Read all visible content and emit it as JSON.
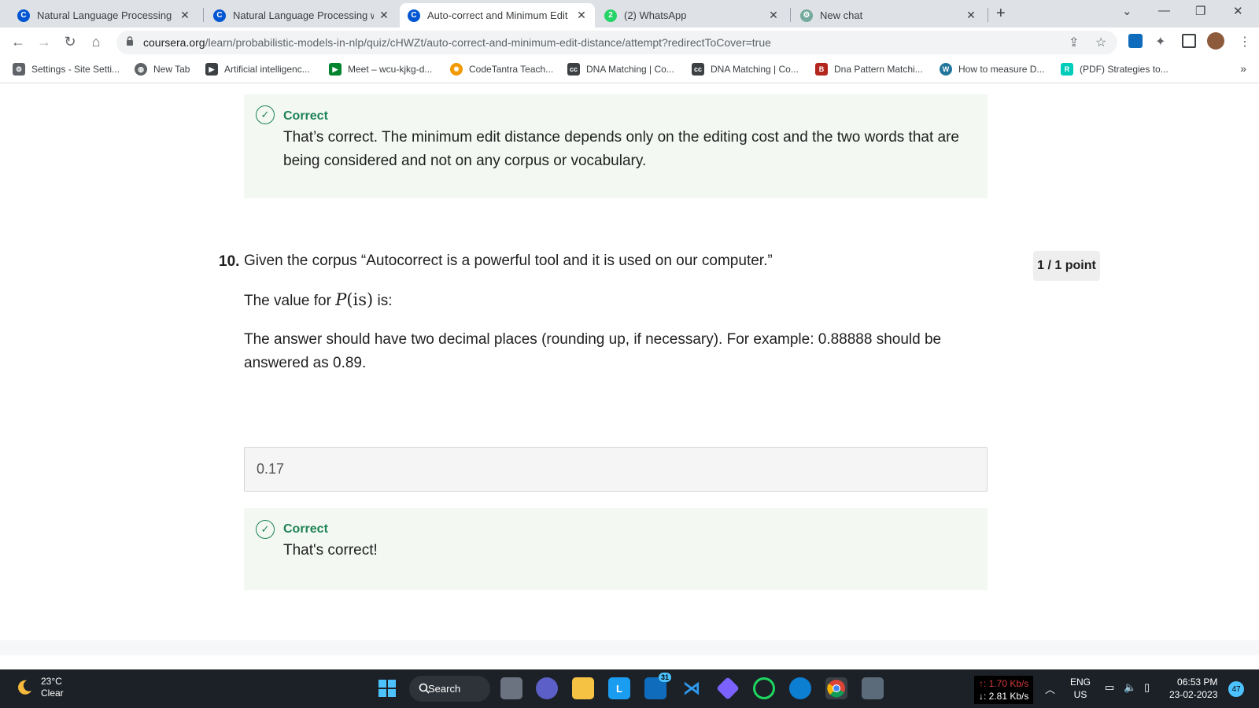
{
  "browser": {
    "tabs": [
      {
        "title": "Natural Language Processing - G",
        "favicon_color": "#0056d2",
        "favicon_glyph": "C",
        "active": false
      },
      {
        "title": "Natural Language Processing wit",
        "favicon_color": "#0056d2",
        "favicon_glyph": "C",
        "active": false
      },
      {
        "title": "Auto-correct and Minimum Edit I",
        "favicon_color": "#0056d2",
        "favicon_glyph": "C",
        "active": true
      },
      {
        "title": "(2) WhatsApp",
        "favicon_color": "#25d366",
        "favicon_glyph": "2",
        "active": false
      },
      {
        "title": "New chat",
        "favicon_color": "#74aa9c",
        "favicon_glyph": "⚙",
        "active": false
      }
    ],
    "url_host": "coursera.org",
    "url_path": "/learn/probabilistic-models-in-nlp/quiz/cHWZt/auto-correct-and-minimum-edit-distance/attempt?redirectToCover=true",
    "bookmarks": [
      {
        "label": "Settings - Site Setti...",
        "color": "#5f6368",
        "glyph": "⚙"
      },
      {
        "label": "New Tab",
        "color": "#5f6368",
        "glyph": "◍"
      },
      {
        "label": "Artificial intelligenc...",
        "color": "#3c4043",
        "glyph": "▶"
      },
      {
        "label": "Meet – wcu-kjkg-d...",
        "color": "#00832d",
        "glyph": "▶"
      },
      {
        "label": "CodeTantra Teach...",
        "color": "#f29900",
        "glyph": "✹"
      },
      {
        "label": "DNA Matching | Co...",
        "color": "#3c4043",
        "glyph": "cc"
      },
      {
        "label": "DNA Matching | Co...",
        "color": "#3c4043",
        "glyph": "cc"
      },
      {
        "label": "Dna Pattern Matchi...",
        "color": "#b3261e",
        "glyph": "B"
      },
      {
        "label": "How to measure D...",
        "color": "#21759b",
        "glyph": "W"
      },
      {
        "label": "(PDF) Strategies to...",
        "color": "#00ccbb",
        "glyph": "R"
      }
    ]
  },
  "quiz": {
    "prev_feedback": {
      "title": "Correct",
      "text": "That’s correct. The minimum edit distance depends only on the editing cost and the two words that are being considered and not on any corpus or vocabulary."
    },
    "question": {
      "number": "10.",
      "line1": "Given the corpus “Autocorrect is a powerful tool and it is used on our computer.”",
      "line2_prefix": "The value for",
      "math_P": "P",
      "math_arg": "(is)",
      "line2_suffix": "is:",
      "instructions": "The answer should have two decimal places (rounding up, if necessary). For example: 0.88888 should be answered as 0.89.",
      "points": "1 / 1 point",
      "answer": "0.17"
    },
    "feedback": {
      "title": "Correct",
      "text": "That's correct!"
    }
  },
  "taskbar": {
    "temperature": "23°C",
    "condition": "Clear",
    "search_label": "Search",
    "mail_badge": "31",
    "net_up": "↑: 1.70 Kb/s",
    "net_down": "↓: 2.81 Kb/s",
    "lang1": "ENG",
    "lang2": "US",
    "time": "06:53 PM",
    "date": "23-02-2023",
    "notifications": "47"
  },
  "colors": {
    "correct_green": "#1f8354",
    "feedback_bg": "#f3f8f3"
  }
}
